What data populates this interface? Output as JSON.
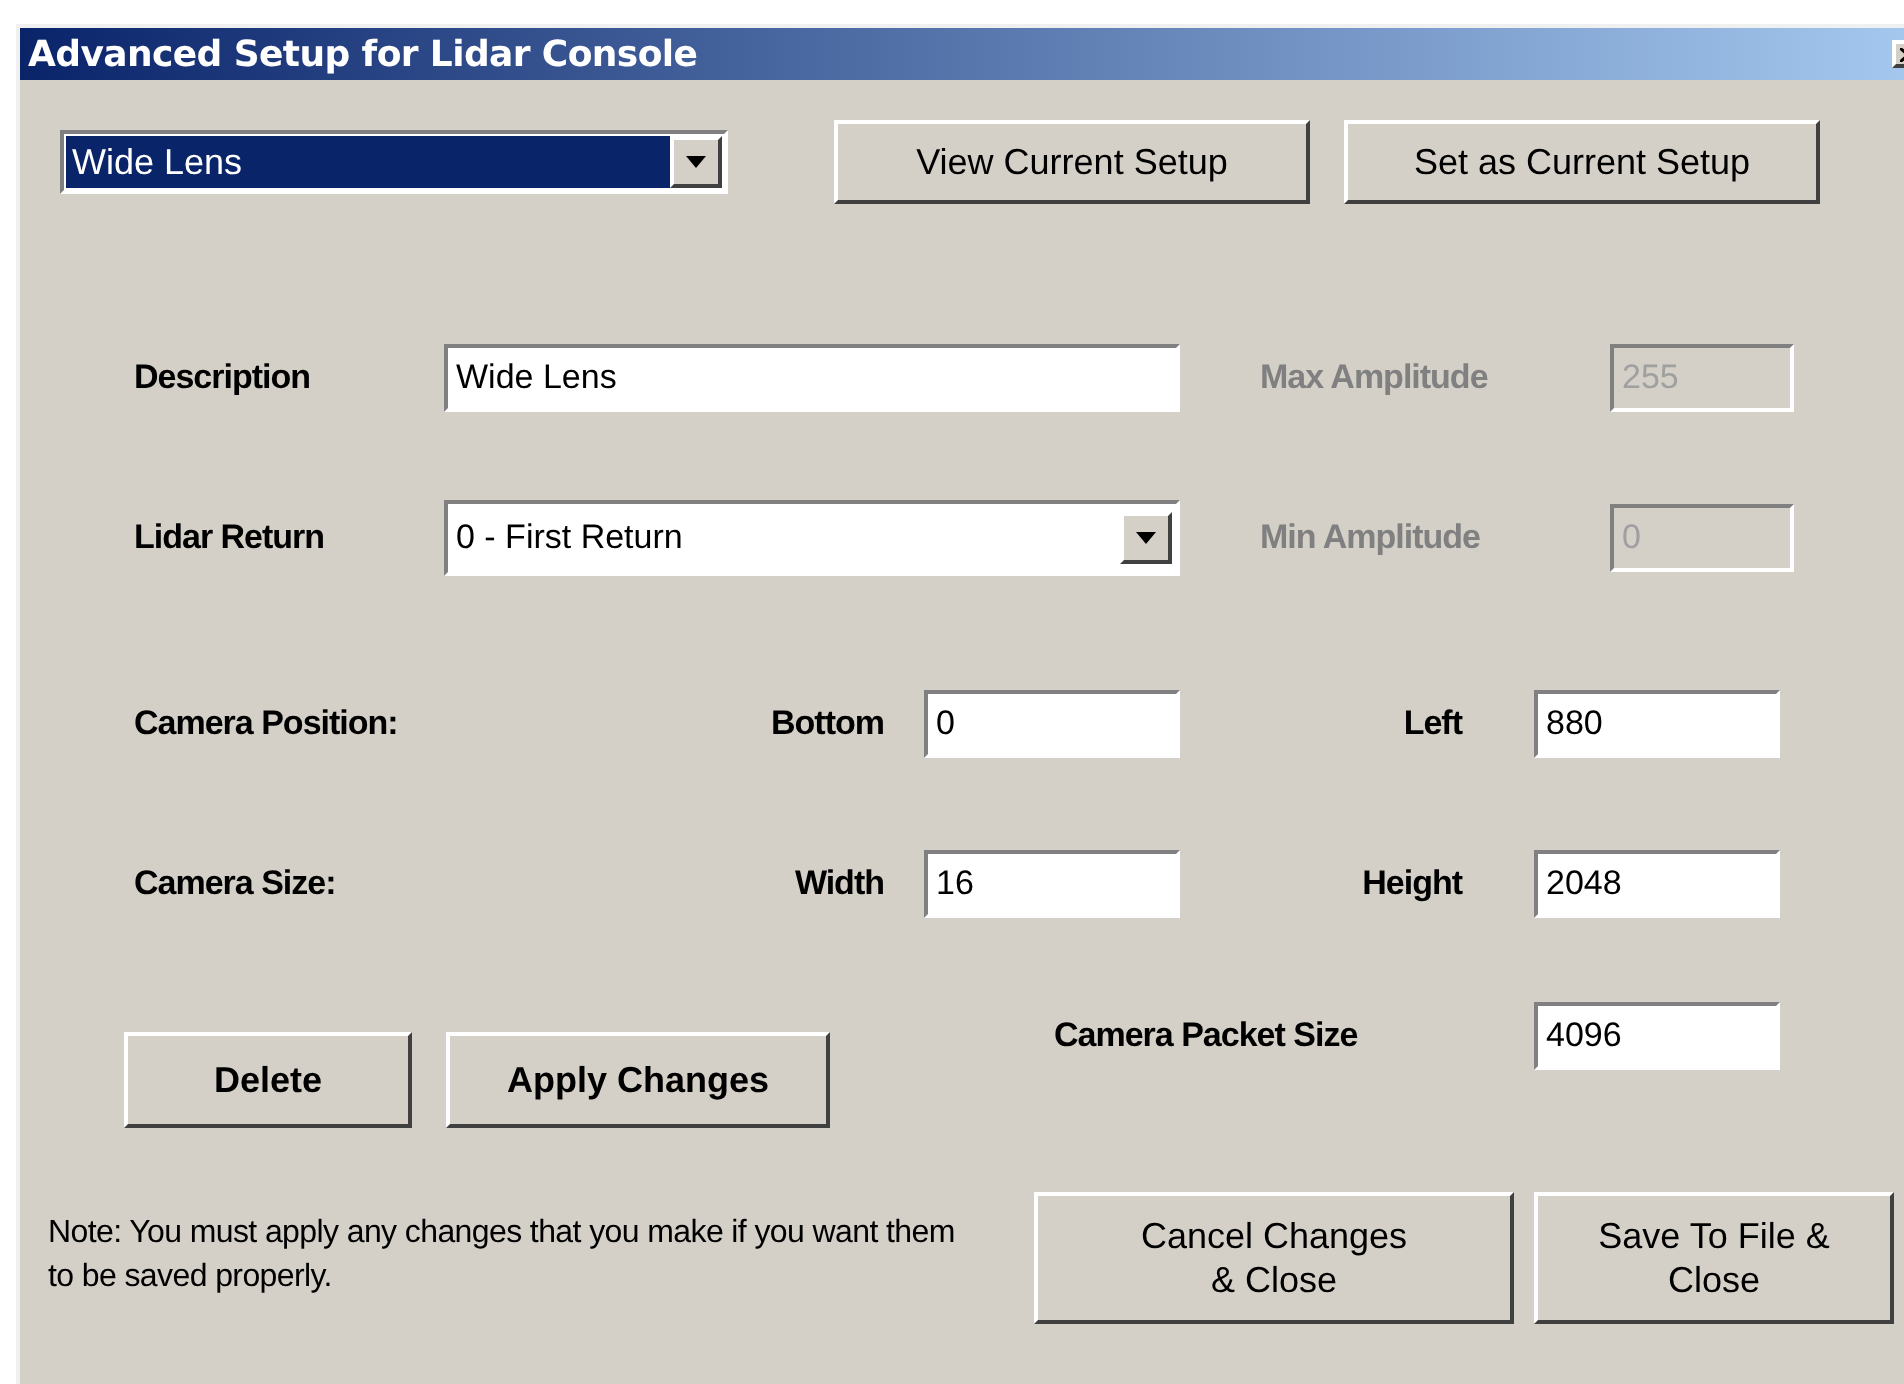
{
  "window": {
    "title": "Advanced Setup for Lidar Console"
  },
  "setup_select": {
    "value": "Wide Lens"
  },
  "top_buttons": [
    "View Current Setup",
    "Set as Current Setup"
  ],
  "description": {
    "label": "Description",
    "value": "Wide Lens"
  },
  "max_amplitude": {
    "label": "Max Amplitude",
    "value": "255",
    "disabled": true
  },
  "lidar_return": {
    "label": "Lidar Return",
    "value": "0 - First Return"
  },
  "min_amplitude": {
    "label": "Min Amplitude",
    "value": "0",
    "disabled": true
  },
  "camera_position": {
    "label": "Camera Position:",
    "first": {
      "label": "Bottom",
      "value": "0"
    },
    "second": {
      "label": "Left",
      "value": "880"
    }
  },
  "camera_size": {
    "label": "Camera Size:",
    "first": {
      "label": "Width",
      "value": "16"
    },
    "second": {
      "label": "Height",
      "value": "2048"
    }
  },
  "camera_packet_size": {
    "label": "Camera Packet Size",
    "value": "4096"
  },
  "action_buttons": [
    "Delete",
    "Apply Changes"
  ],
  "note": "Note: You must apply any changes that you make if you want them to be saved properly.",
  "footer_buttons": [
    "Cancel Changes\n& Close",
    "Save To File &\nClose"
  ]
}
